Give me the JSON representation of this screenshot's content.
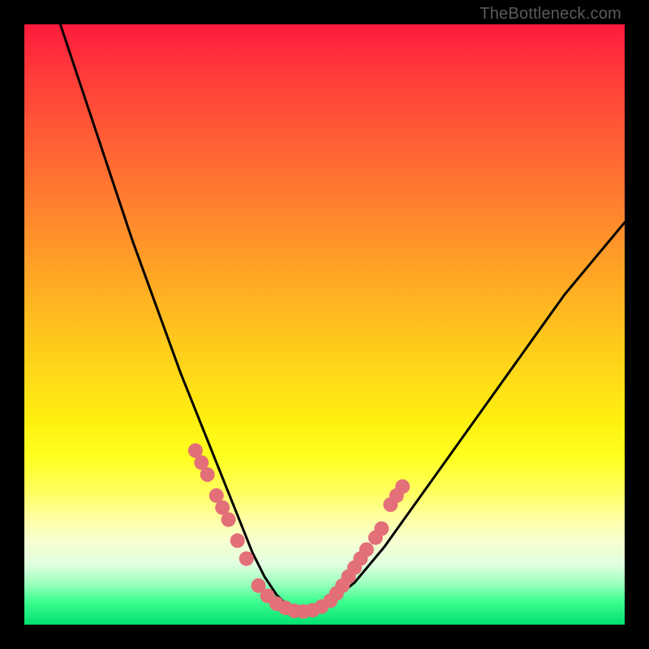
{
  "watermark": "TheBottleneck.com",
  "chart_data": {
    "type": "line",
    "title": "",
    "xlabel": "",
    "ylabel": "",
    "xlim": [
      0,
      100
    ],
    "ylim": [
      0,
      100
    ],
    "grid": false,
    "series": [
      {
        "name": "curve",
        "color": "#000000",
        "x": [
          6,
          10,
          14,
          18,
          22,
          26,
          28,
          30,
          32,
          34,
          36,
          38,
          40,
          42,
          44,
          46,
          48,
          50,
          55,
          60,
          65,
          70,
          75,
          80,
          85,
          90,
          95,
          100
        ],
        "y": [
          100,
          88,
          76,
          64,
          53,
          42,
          37,
          32,
          27,
          22,
          17,
          12,
          8,
          5,
          3,
          2,
          2,
          3,
          7,
          13,
          20,
          27,
          34,
          41,
          48,
          55,
          61,
          67
        ]
      },
      {
        "name": "dots-left",
        "color": "#e36f78",
        "type": "scatter",
        "x": [
          28.5,
          29.5,
          30.5,
          32.0,
          33.0,
          34.0,
          35.5,
          37.0
        ],
        "y": [
          29.0,
          27.0,
          25.0,
          21.5,
          19.5,
          17.5,
          14.0,
          11.0
        ]
      },
      {
        "name": "dots-bottom",
        "color": "#e36f78",
        "type": "scatter",
        "x": [
          39.0,
          40.5,
          42.0,
          43.5,
          45.0,
          46.5,
          48.0,
          49.5,
          51.0,
          52.0
        ],
        "y": [
          6.5,
          4.8,
          3.5,
          2.8,
          2.3,
          2.2,
          2.4,
          3.0,
          4.0,
          5.2
        ]
      },
      {
        "name": "dots-right",
        "color": "#e36f78",
        "type": "scatter",
        "x": [
          53.0,
          54.0,
          55.0,
          56.0,
          57.0,
          58.5,
          59.5,
          61.0,
          62.0,
          63.0
        ],
        "y": [
          6.5,
          8.0,
          9.5,
          11.0,
          12.5,
          14.5,
          16.0,
          20.0,
          21.5,
          23.0
        ]
      }
    ]
  },
  "colors": {
    "dot_fill": "#e36f78",
    "curve": "#000000",
    "frame": "#000000"
  }
}
